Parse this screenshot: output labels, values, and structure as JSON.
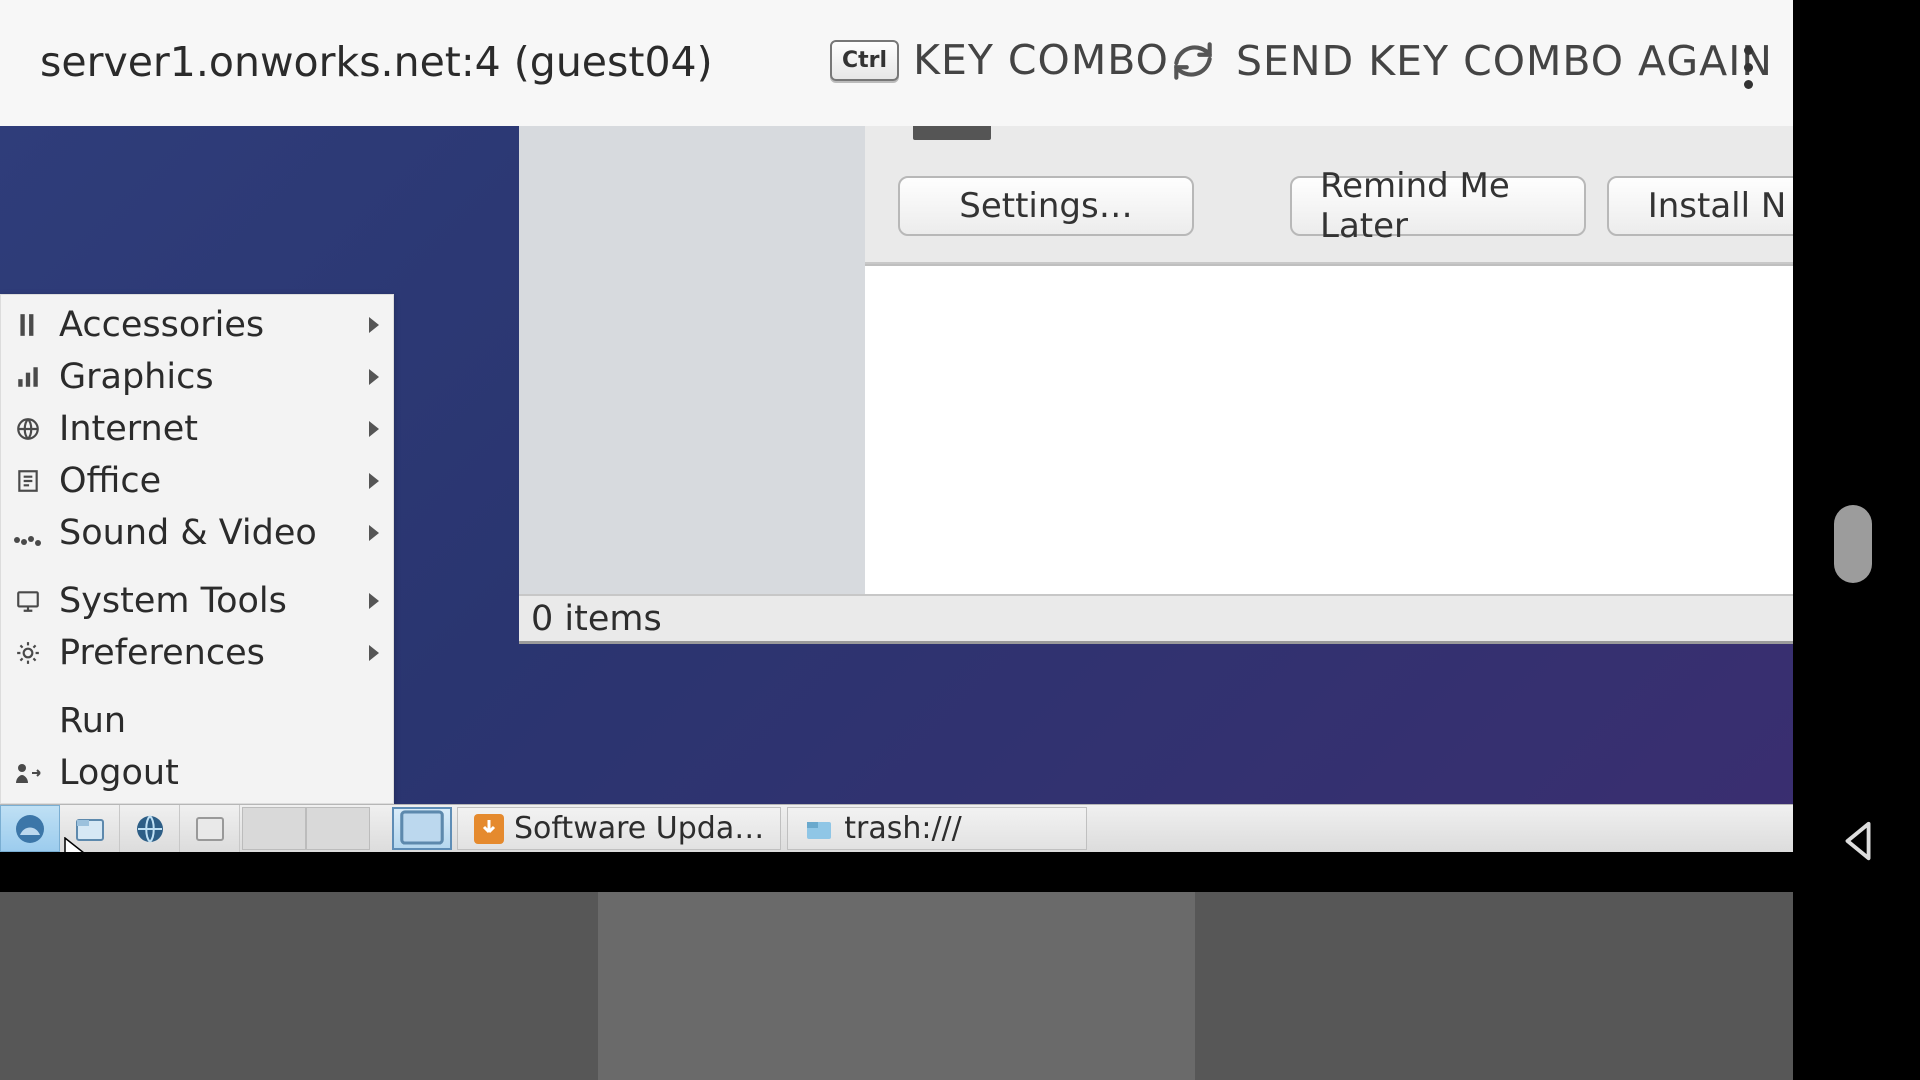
{
  "top": {
    "title": "server1.onworks.net:4 (guest04)",
    "key_combo_key": "Ctrl",
    "key_combo_label": "KEY COMBO",
    "send_again_label": "SEND KEY COMBO AGAIN"
  },
  "dialog": {
    "settings": "Settings…",
    "later": "Remind Me Later",
    "install": "Install N"
  },
  "file_manager": {
    "status": "0 items"
  },
  "menu": {
    "items": [
      {
        "label": "Accessories",
        "icon": "accessories-icon",
        "submenu": true
      },
      {
        "label": "Graphics",
        "icon": "graphics-icon",
        "submenu": true
      },
      {
        "label": "Internet",
        "icon": "internet-icon",
        "submenu": true
      },
      {
        "label": "Office",
        "icon": "office-icon",
        "submenu": true
      },
      {
        "label": "Sound & Video",
        "icon": "sound-video-icon",
        "submenu": true
      },
      {
        "label": "System Tools",
        "icon": "system-tools-icon",
        "submenu": true
      },
      {
        "label": "Preferences",
        "icon": "preferences-icon",
        "submenu": true
      },
      {
        "label": "Run",
        "icon": "",
        "submenu": false
      },
      {
        "label": "Logout",
        "icon": "logout-icon",
        "submenu": false
      }
    ]
  },
  "taskbar": {
    "tasks": [
      {
        "label": "Software Upda…",
        "icon": "updater-icon"
      },
      {
        "label": "trash:///",
        "icon": "folder-icon"
      }
    ]
  }
}
